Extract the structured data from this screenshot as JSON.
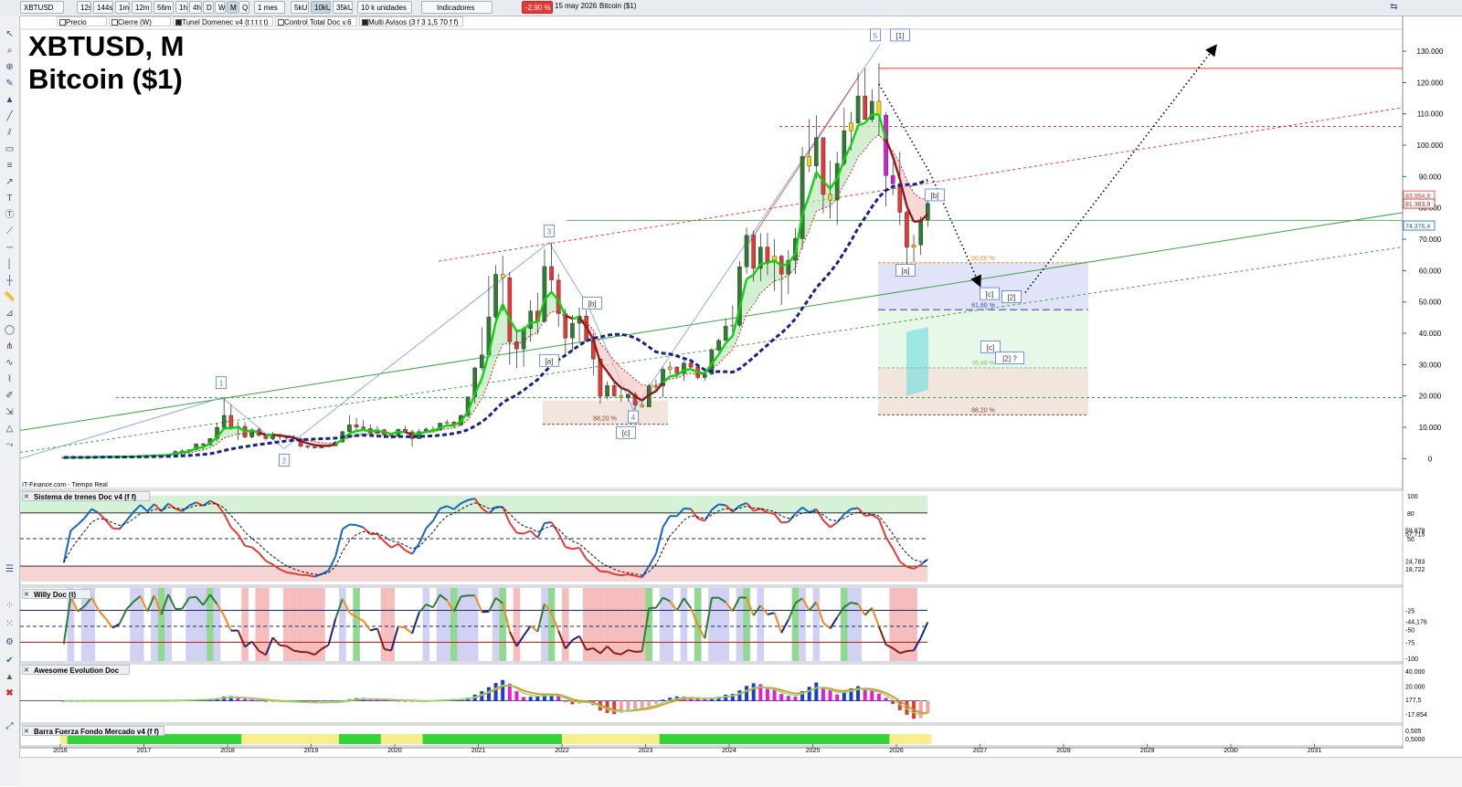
{
  "toolbar": {
    "symbol": "XBTUSD",
    "timeframes": [
      "12s",
      "144s",
      "1m",
      "12m",
      "56m",
      "1h",
      "4h",
      "D",
      "W",
      "M",
      "Q"
    ],
    "selected_timeframe": "M",
    "period": "1 mes",
    "bar_types": [
      "5kU",
      "10kU",
      "35kU"
    ],
    "selected_bar_type": "10kU",
    "units": "10 k unidades",
    "indicators_label": "Indicadores",
    "change_pct": "-2,90 %",
    "date": "15 may 2026",
    "instrument_name": "Bitcoin ($1)"
  },
  "legend_items": [
    {
      "label": "Precio",
      "on": false
    },
    {
      "label": "Cierre (W)",
      "on": false
    },
    {
      "label": "Tunel Domenec v4 (t t t t t)",
      "on": true
    },
    {
      "label": "Control Total Doc v.6",
      "on": false
    },
    {
      "label": "Multi Avisos (3 f 3 1,5 70 f f)",
      "on": true
    }
  ],
  "title": {
    "line1": "XBTUSD, M",
    "line2": "Bitcoin ($1)"
  },
  "source_note": "IT-Finance.com - Tiempo Real",
  "panels": {
    "trenes": "Sistema de trenes Doc v4 (f f)",
    "willy": "Willy Doc (t)",
    "awesome": "Awesome Evolution Doc",
    "barra": "Barra Fuerza Fondo Mercado v4 (f f)"
  },
  "colors": {
    "up": "#2e7d32",
    "down": "#e53935",
    "doji": "#f5d90a",
    "magenta": "#d81bd8",
    "trend_green": "#10d010",
    "trend_red": "#b71c1c",
    "dotted_blue": "#1a237e"
  },
  "chart_data": [
    {
      "type": "candlestick",
      "title": "XBTUSD, M",
      "subtitle": "Bitcoin ($1)",
      "x_labels": [
        "2016",
        "2017",
        "2018",
        "2019",
        "2020",
        "2021",
        "2022",
        "2023",
        "2024",
        "2025",
        "2026",
        "2027",
        "2028",
        "2029",
        "2030",
        "2031"
      ],
      "ylim": [
        -6000,
        137000
      ],
      "yticks": [
        0,
        10000,
        20000,
        30000,
        40000,
        50000,
        60000,
        70000,
        80000,
        90000,
        100000,
        110000,
        120000,
        130000
      ],
      "ytick_labels": [
        "0",
        "10.000",
        "20.000",
        "30.000",
        "40.000",
        "50.000",
        "60.000",
        "70.000",
        "80.000",
        "90.000",
        "100.000",
        "110.000",
        "120.000",
        "130.000"
      ],
      "ohlc_monthly_from_2016_01": [
        [
          430,
          440,
          350,
          370
        ],
        [
          370,
          440,
          365,
          437
        ],
        [
          437,
          440,
          390,
          416
        ],
        [
          416,
          470,
          410,
          448
        ],
        [
          448,
          540,
          440,
          531
        ],
        [
          531,
          780,
          525,
          672
        ],
        [
          672,
          700,
          610,
          624
        ],
        [
          624,
          630,
          475,
          576
        ],
        [
          576,
          615,
          570,
          609
        ],
        [
          609,
          740,
          605,
          700
        ],
        [
          700,
          750,
          680,
          745
        ],
        [
          745,
          980,
          740,
          966
        ],
        [
          966,
          1150,
          755,
          970
        ],
        [
          970,
          1200,
          940,
          1190
        ],
        [
          1190,
          1300,
          890,
          1080
        ],
        [
          1080,
          1350,
          1070,
          1350
        ],
        [
          1350,
          2760,
          1340,
          2300
        ],
        [
          2300,
          2980,
          2080,
          2480
        ],
        [
          2480,
          2900,
          1830,
          2870
        ],
        [
          2870,
          4900,
          2730,
          4740
        ],
        [
          4740,
          5000,
          2970,
          4340
        ],
        [
          4340,
          6470,
          4100,
          6450
        ],
        [
          6450,
          11400,
          5500,
          9950
        ],
        [
          9950,
          19800,
          9500,
          13800
        ],
        [
          13800,
          17200,
          9200,
          10100
        ],
        [
          10100,
          11800,
          5900,
          10300
        ],
        [
          10300,
          11700,
          6500,
          6900
        ],
        [
          6900,
          9800,
          6500,
          9250
        ],
        [
          9250,
          10000,
          7000,
          7500
        ],
        [
          7500,
          7800,
          5800,
          6400
        ],
        [
          6400,
          8500,
          5900,
          7750
        ],
        [
          7750,
          7800,
          5900,
          7000
        ],
        [
          7000,
          7400,
          6100,
          6600
        ],
        [
          6600,
          7500,
          6200,
          6300
        ],
        [
          6300,
          6600,
          3500,
          4000
        ],
        [
          4000,
          4200,
          3200,
          3700
        ],
        [
          3700,
          4100,
          3400,
          3450
        ],
        [
          3450,
          4200,
          3400,
          3820
        ],
        [
          3820,
          4100,
          3700,
          4100
        ],
        [
          4100,
          5600,
          4050,
          5300
        ],
        [
          5300,
          9000,
          5200,
          8600
        ],
        [
          8600,
          13800,
          7500,
          10800
        ],
        [
          10800,
          13100,
          9100,
          10100
        ],
        [
          10100,
          12300,
          9350,
          9600
        ],
        [
          9600,
          10900,
          7700,
          8300
        ],
        [
          8300,
          10400,
          7300,
          9200
        ],
        [
          9200,
          9500,
          6500,
          7550
        ],
        [
          7550,
          7700,
          6400,
          7200
        ],
        [
          7200,
          9600,
          6900,
          9350
        ],
        [
          9350,
          10500,
          8500,
          8550
        ],
        [
          8550,
          9200,
          3800,
          6400
        ],
        [
          6400,
          9450,
          6200,
          8600
        ],
        [
          8600,
          10000,
          8100,
          9450
        ],
        [
          9450,
          10400,
          8900,
          9130
        ],
        [
          9130,
          11400,
          9000,
          11350
        ],
        [
          11350,
          12450,
          10500,
          11650
        ],
        [
          11650,
          12050,
          9900,
          10780
        ],
        [
          10780,
          14000,
          10400,
          13800
        ],
        [
          13800,
          19900,
          13200,
          19700
        ],
        [
          19700,
          29300,
          17600,
          28950
        ],
        [
          28950,
          41900,
          28100,
          33100
        ],
        [
          33100,
          58300,
          32300,
          45200
        ],
        [
          45200,
          61700,
          43000,
          58800
        ],
        [
          58800,
          64800,
          47000,
          57700
        ],
        [
          57700,
          59500,
          30000,
          37300
        ],
        [
          37300,
          41300,
          28800,
          35000
        ],
        [
          35000,
          42400,
          29300,
          41500
        ],
        [
          41500,
          50500,
          37300,
          47100
        ],
        [
          47100,
          52900,
          39600,
          43800
        ],
        [
          43800,
          66900,
          43300,
          61300
        ],
        [
          61300,
          69000,
          53200,
          57000
        ],
        [
          57000,
          59000,
          42000,
          46300
        ],
        [
          46300,
          47900,
          33000,
          38500
        ],
        [
          38500,
          45800,
          34300,
          43200
        ],
        [
          43200,
          48200,
          37200,
          45500
        ],
        [
          45500,
          47400,
          37600,
          37700
        ],
        [
          37700,
          40000,
          26700,
          31800
        ],
        [
          31800,
          31900,
          17600,
          19900
        ],
        [
          19900,
          24600,
          18900,
          23300
        ],
        [
          23300,
          25200,
          19500,
          20050
        ],
        [
          20050,
          22700,
          18150,
          19400
        ],
        [
          19400,
          20900,
          18200,
          20500
        ],
        [
          20500,
          21400,
          15500,
          17150
        ],
        [
          17150,
          18400,
          16300,
          16550
        ],
        [
          16550,
          23900,
          16500,
          23130
        ],
        [
          23130,
          25200,
          21400,
          23150
        ],
        [
          23150,
          29200,
          19600,
          28500
        ],
        [
          28500,
          30900,
          26900,
          29250
        ],
        [
          29250,
          29400,
          25800,
          27200
        ],
        [
          27200,
          31400,
          24800,
          30500
        ],
        [
          30500,
          31800,
          28900,
          29200
        ],
        [
          29200,
          30200,
          25200,
          25900
        ],
        [
          25900,
          27500,
          24900,
          26970
        ],
        [
          26970,
          35200,
          26600,
          34650
        ],
        [
          34650,
          38400,
          34100,
          37700
        ],
        [
          37700,
          44700,
          37600,
          42300
        ],
        [
          42300,
          48900,
          38600,
          42600
        ],
        [
          42600,
          63000,
          41900,
          61200
        ],
        [
          61200,
          73800,
          59100,
          71300
        ],
        [
          71300,
          72800,
          56500,
          60700
        ],
        [
          60700,
          71900,
          56600,
          67500
        ],
        [
          67500,
          72000,
          58500,
          62700
        ],
        [
          62700,
          70000,
          53500,
          64600
        ],
        [
          64600,
          65100,
          49000,
          58900
        ],
        [
          58900,
          66500,
          52600,
          63300
        ],
        [
          63300,
          73600,
          58900,
          70200
        ],
        [
          70200,
          99500,
          66800,
          96400
        ],
        [
          96400,
          108300,
          91400,
          93400
        ],
        [
          93400,
          109600,
          89300,
          102400
        ],
        [
          102400,
          102500,
          78200,
          84300
        ],
        [
          84300,
          95000,
          76600,
          82500
        ],
        [
          82500,
          97900,
          74500,
          94200
        ],
        [
          94200,
          111900,
          93300,
          104600
        ],
        [
          104600,
          110600,
          98300,
          107100
        ],
        [
          107100,
          123200,
          105100,
          115700
        ],
        [
          115700,
          124500,
          108100,
          108200
        ],
        [
          108200,
          117900,
          107300,
          114000
        ],
        [
          114000,
          126200,
          103000,
          109600
        ],
        [
          109600,
          110600,
          80500,
          90300
        ],
        [
          90300,
          94600,
          84000,
          87700
        ],
        [
          87700,
          97900,
          74500,
          78600
        ],
        [
          78600,
          79300,
          60000,
          67500
        ],
        [
          67500,
          71400,
          62700,
          68200
        ],
        [
          68200,
          77300,
          65000,
          76200
        ],
        [
          76200,
          82900,
          74000,
          81400
        ]
      ],
      "annotations": [
        "1",
        "2",
        "3",
        "[b]",
        "[a]",
        "[c]",
        "4",
        "5",
        "[1]",
        "[a]",
        "[b]",
        "[c]",
        "[2]",
        "[c]",
        "[2] ?"
      ],
      "fib_levels": [
        {
          "label": "50,00 %",
          "value": 62500
        },
        {
          "label": "61,80 %",
          "value": 47500
        },
        {
          "label": "76,40 %",
          "value": 29000
        },
        {
          "label": "88,20 %",
          "value": 14000
        }
      ],
      "price_tags": [
        "83.954,8",
        "81.363,9",
        "74.376,4"
      ]
    },
    {
      "type": "line",
      "title": "Sistema de trenes Doc v4 (f f)",
      "ylim": [
        0,
        100
      ],
      "ytick_labels": [
        "100",
        "80",
        "59,878",
        "57,715",
        "50",
        "24,783",
        "18,722"
      ],
      "series_note": "oscillator lines in 0-100 range"
    },
    {
      "type": "line",
      "title": "Willy Doc (t)",
      "ylim": [
        -100,
        0
      ],
      "ytick_labels": [
        "-25",
        "-44,176",
        "-50",
        "-75",
        "-100"
      ]
    },
    {
      "type": "bar",
      "title": "Awesome Evolution Doc",
      "ylim": [
        -25000,
        45000
      ],
      "ytick_labels": [
        "40.000",
        "20.000",
        "177,5",
        "-17.854"
      ]
    },
    {
      "type": "heatmap",
      "title": "Barra Fuerza Fondo Mercado v4 (f f)",
      "ytick_labels": [
        "0,505",
        "0,5000"
      ]
    }
  ]
}
